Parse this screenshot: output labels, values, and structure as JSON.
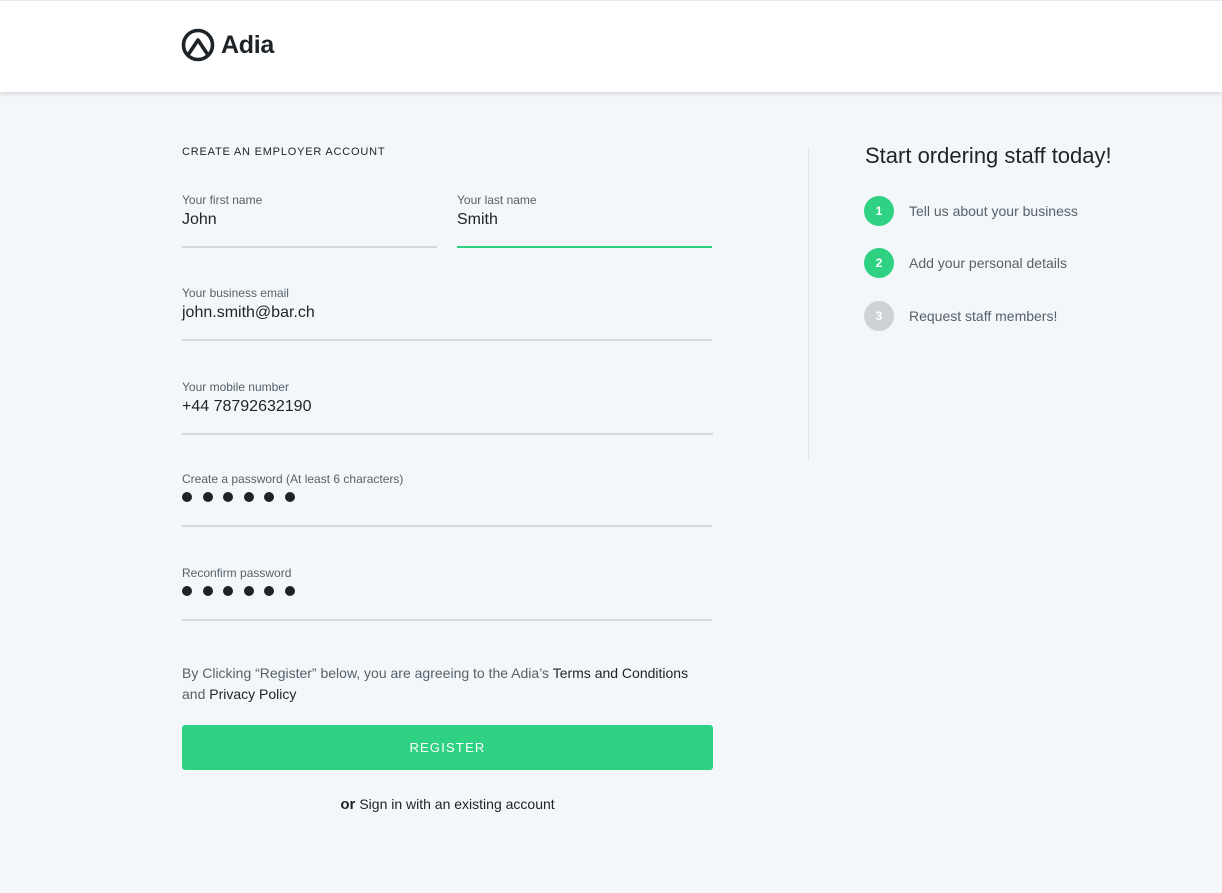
{
  "brand": {
    "name": "Adia",
    "accent": "#2ed282"
  },
  "form": {
    "title": "CREATE AN EMPLOYER ACCOUNT",
    "first_name": {
      "label": "Your first name",
      "value": "John"
    },
    "last_name": {
      "label": "Your last name",
      "value": "Smith"
    },
    "email": {
      "label": "Your business email",
      "value": "john.smith@bar.ch"
    },
    "mobile": {
      "label": "Your mobile number",
      "value": "+44 78792632190"
    },
    "password": {
      "label": "Create a password (At least 6 characters)",
      "masked_length": 6
    },
    "confirm_password": {
      "label": "Reconfirm password",
      "masked_length": 6
    },
    "terms": {
      "prefix": "By Clicking “Register” below, you are agreeing to the Adia’s ",
      "terms_link": "Terms and Conditions",
      "middle": "and ",
      "privacy_link": "Privacy Policy"
    },
    "register_label": "REGISTER",
    "signin": {
      "or": "or",
      "link": "Sign in with an existing account"
    }
  },
  "sidebar": {
    "title": "Start ordering staff today!",
    "steps": [
      {
        "number": "1",
        "label": "Tell us about your business",
        "status": "done"
      },
      {
        "number": "2",
        "label": "Add your personal details",
        "status": "done"
      },
      {
        "number": "3",
        "label": "Request staff members!",
        "status": "todo"
      }
    ]
  }
}
